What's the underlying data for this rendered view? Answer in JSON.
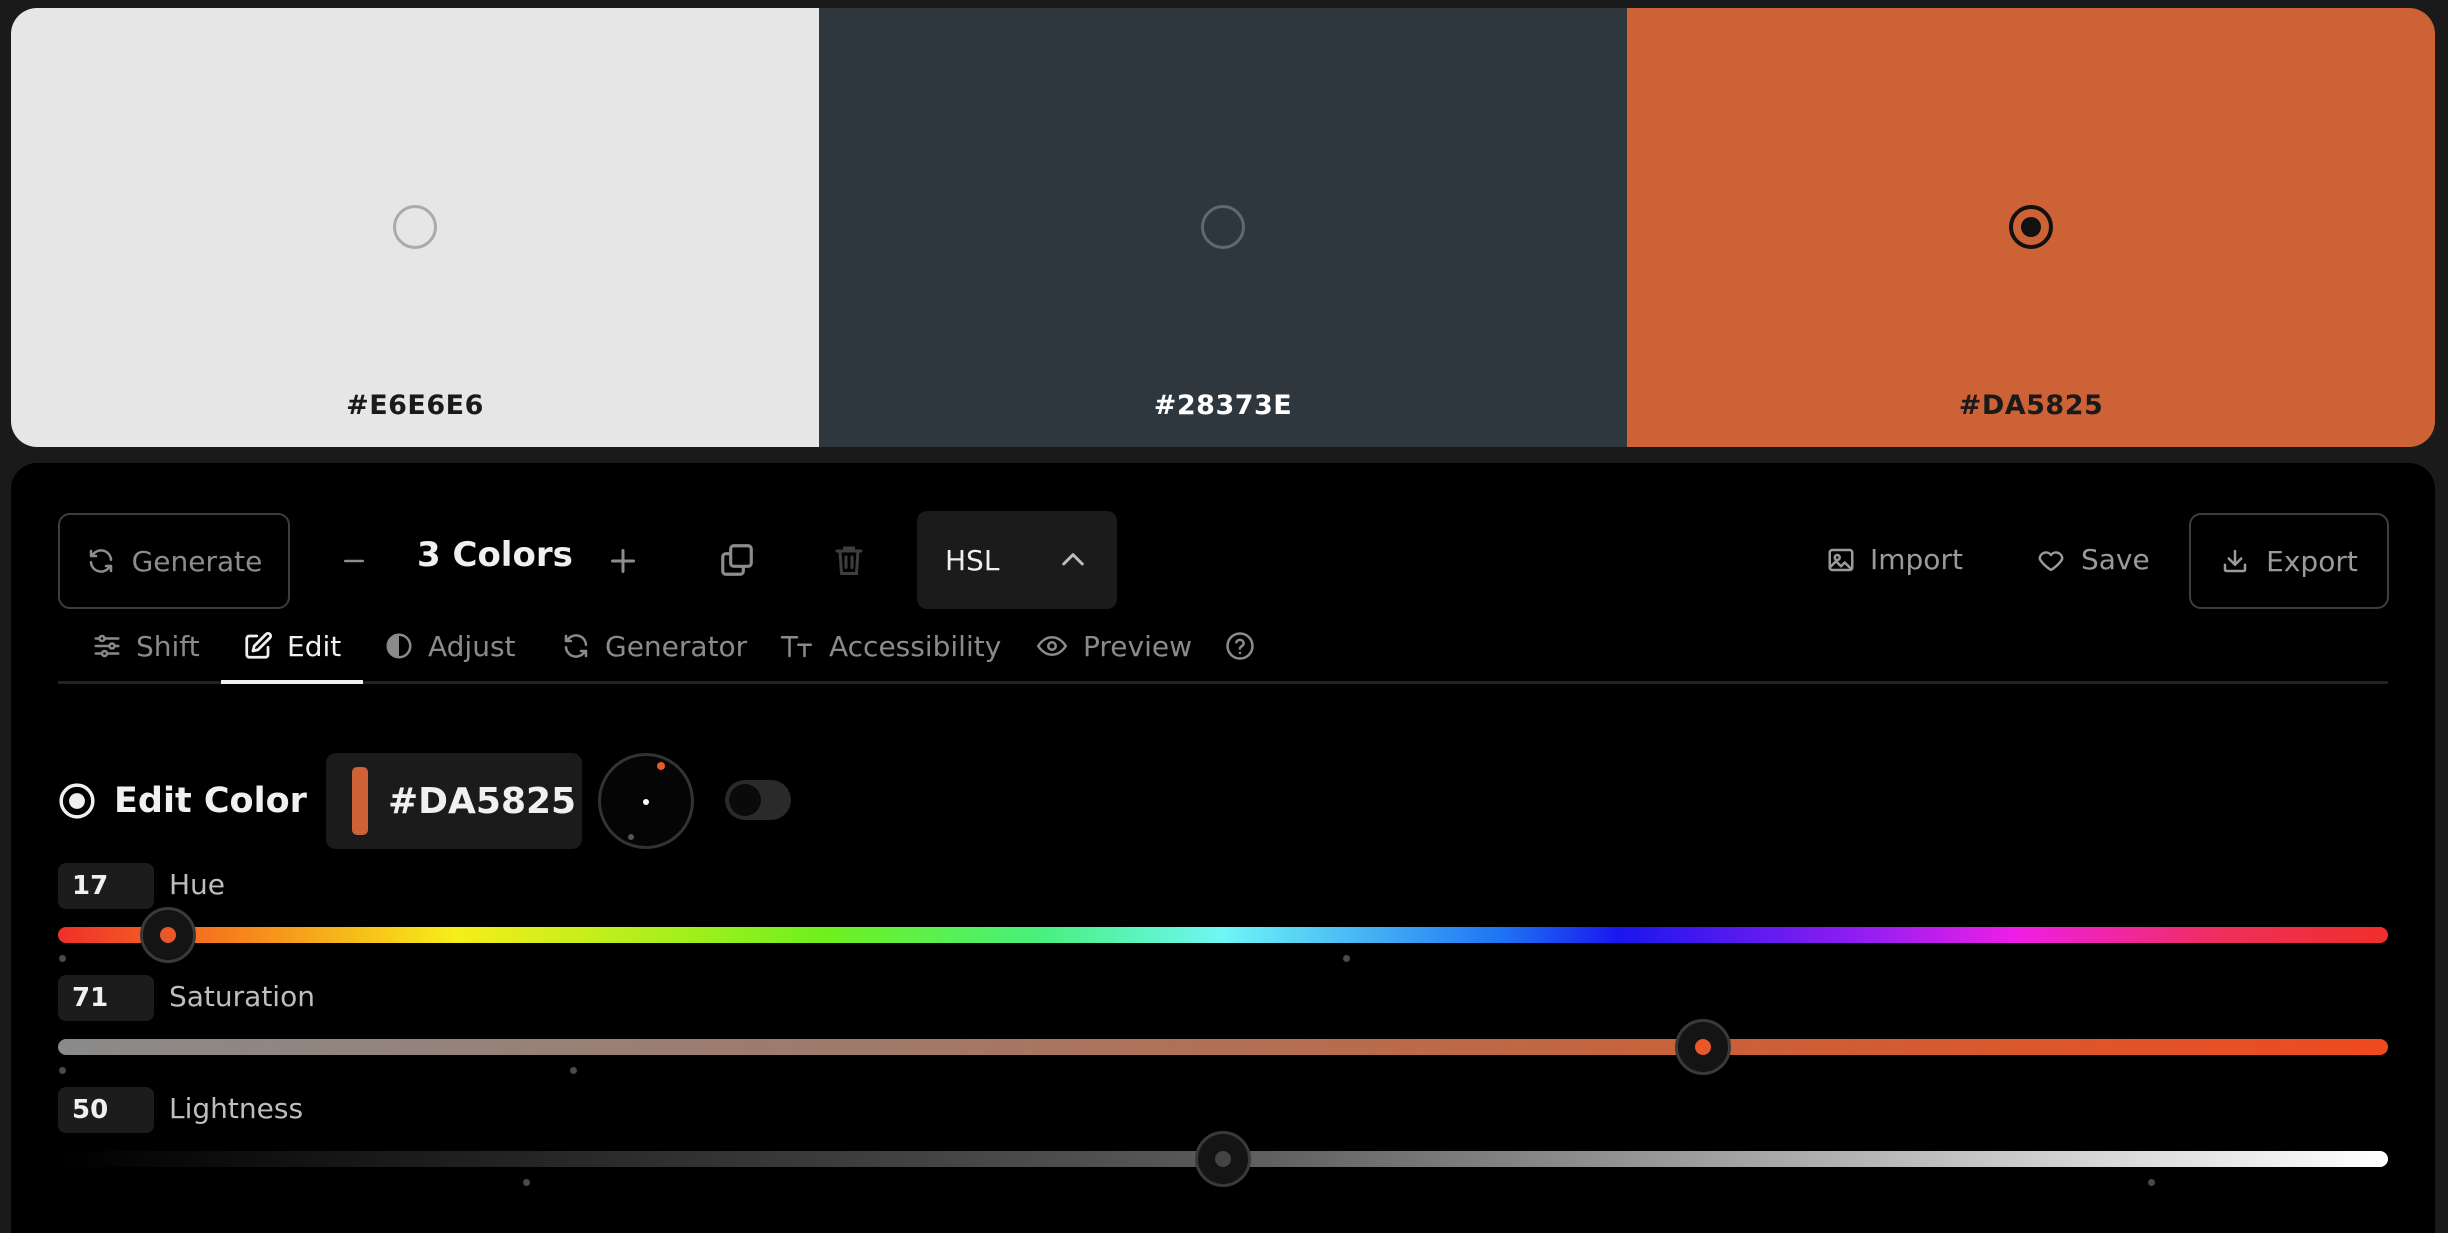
{
  "swatches": [
    {
      "hex": "#E6E6E6",
      "color": "#e6e6e6",
      "text_color": "#1a1a1a",
      "radio_border": "#aaaaaa",
      "selected": false
    },
    {
      "hex": "#28373E",
      "color": "#2e373e",
      "text_color": "#ffffff",
      "radio_border": "#5d6a70",
      "selected": false
    },
    {
      "hex": "#DA5825",
      "color": "#cd6236",
      "text_color": "#1a1a1a",
      "radio_border": "#111111",
      "selected": true
    }
  ],
  "toolbar": {
    "generate_label": "Generate",
    "colors_count_label": "3 Colors",
    "mode_label": "HSL",
    "import_label": "Import",
    "save_label": "Save",
    "export_label": "Export"
  },
  "tabs": [
    {
      "label": "Shift",
      "icon": "sliders-icon"
    },
    {
      "label": "Edit",
      "icon": "edit-icon",
      "active": true
    },
    {
      "label": "Adjust",
      "icon": "contrast-icon"
    },
    {
      "label": "Generator",
      "icon": "refresh-icon"
    },
    {
      "label": "Accessibility",
      "icon": "text-size-icon"
    },
    {
      "label": "Preview",
      "icon": "eye-icon"
    },
    {
      "label": "",
      "icon": "help-icon"
    }
  ],
  "edit": {
    "title": "Edit Color",
    "hex_value": "#DA5825",
    "swatch_color": "#cd6236",
    "toggle_on": false
  },
  "sliders": [
    {
      "name": "Hue",
      "value": "17",
      "fraction": 0.047,
      "dot_color": "#e8582a"
    },
    {
      "name": "Saturation",
      "value": "71",
      "fraction": 0.706,
      "dot_color": "#e8582a"
    },
    {
      "name": "Lightness",
      "value": "50",
      "fraction": 0.5,
      "dot_color": "#444444"
    }
  ],
  "colors": {
    "accent": "#e8582a",
    "panel_bg": "#000000",
    "muted_text": "#8c8c8c"
  }
}
